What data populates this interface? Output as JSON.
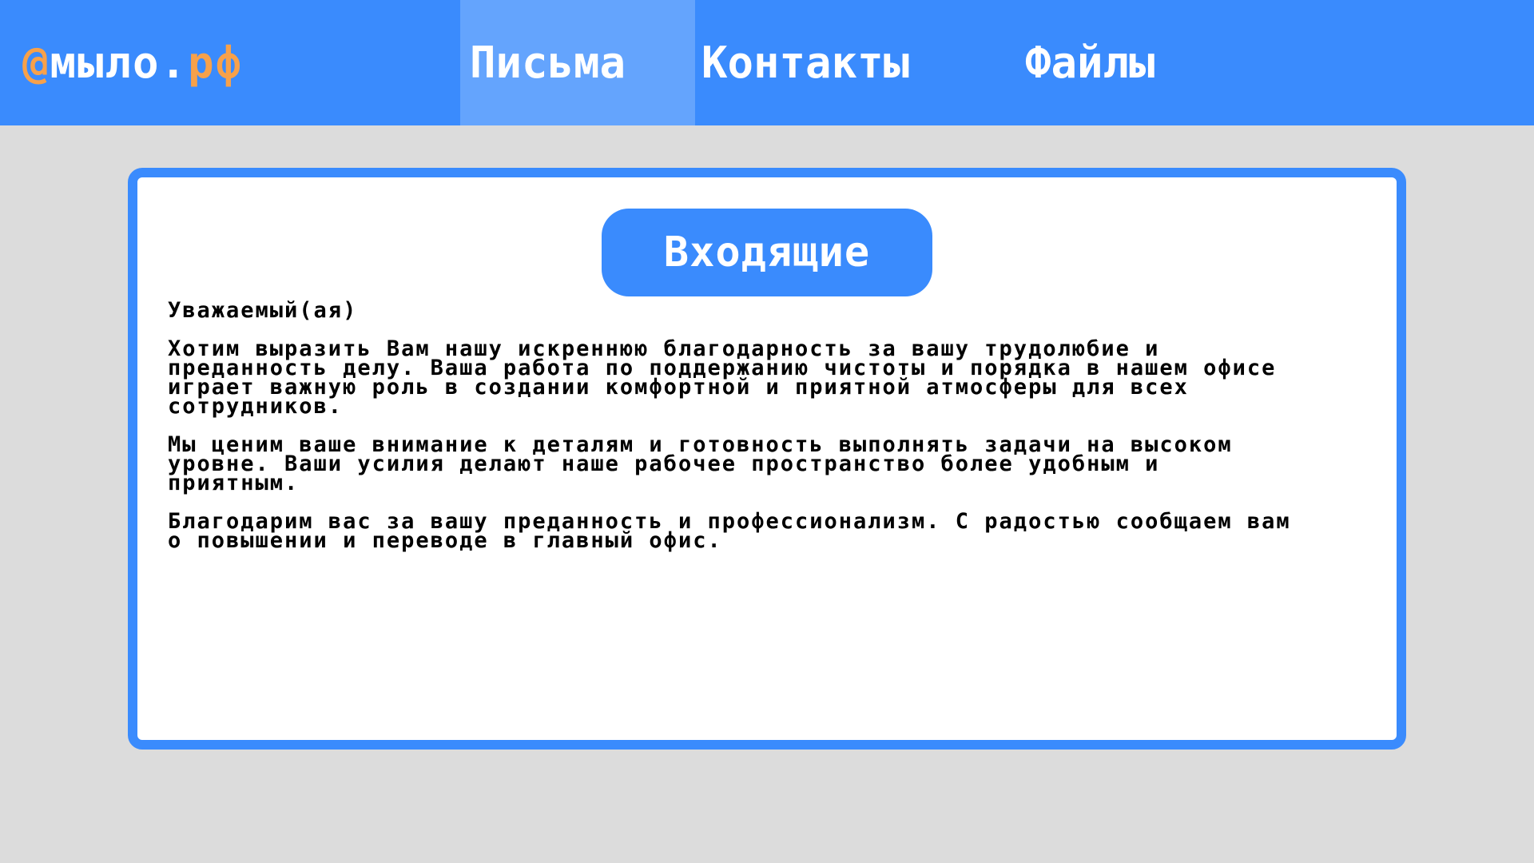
{
  "header": {
    "logo_at": "@",
    "logo_name": "мыло.",
    "logo_tld": "рф",
    "nav": [
      {
        "label": "Письма",
        "active": true
      },
      {
        "label": "Контакты",
        "active": false
      },
      {
        "label": "Файлы",
        "active": false
      }
    ]
  },
  "inbox": {
    "title": "Входящие",
    "greeting": "Уважаемый(ая)",
    "paragraphs": [
      "Хотим выразить Вам нашу искреннюю благодарность за вашу трудолюбие и преданность делу. Ваша работа по поддержанию чистоты и порядка в нашем офисе играет важную роль в создании комфортной и приятной атмосферы для всех сотрудников.",
      "Мы ценим ваше внимание к деталям и готовность выполнять задачи на высоком уровне. Ваши усилия делают наше рабочее пространство более удобным и приятным.",
      "Благодарим вас за вашу преданность и профессионализм. С радостью сообщаем вам о повышении и переводе в  главный офис."
    ]
  },
  "colors": {
    "header_bg": "#3a8bfd",
    "active_tab_bg": "#64a4fd",
    "logo_accent": "#f7a14a",
    "page_bg": "#dcdcdc",
    "panel_border": "#3a8bfd"
  }
}
